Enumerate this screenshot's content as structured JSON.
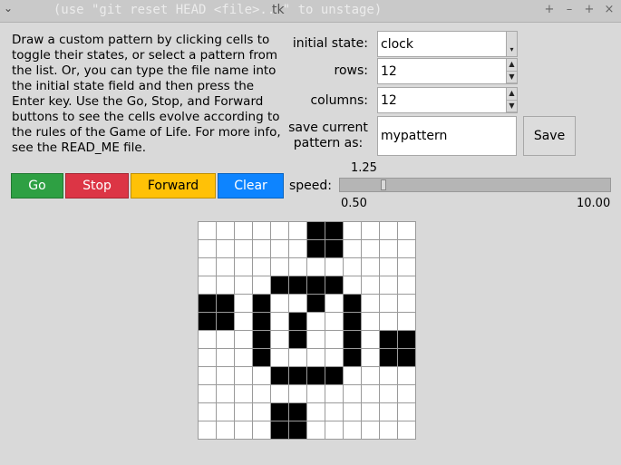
{
  "window": {
    "title": "tk",
    "ghost_text": "  (use \"git reset HEAD <file>...\" to unstage)"
  },
  "instructions": "Draw a custom pattern by clicking cells to toggle their states, or select a pattern from the list. Or, you can type the file name into the initial state field and then press the Enter key. Use the Go, Stop, and Forward buttons to see the cells evolve according to the rules of the Game of Life. For more info, see the READ_ME file.",
  "form": {
    "initial_state_label": "initial state:",
    "initial_state_value": "clock",
    "rows_label": "rows:",
    "rows_value": "12",
    "columns_label": "columns:",
    "columns_value": "12",
    "save_label_line1": "save current",
    "save_label_line2": "pattern as:",
    "save_value": "mypattern",
    "save_button": "Save"
  },
  "controls": {
    "go": "Go",
    "stop": "Stop",
    "forward": "Forward",
    "clear": "Clear",
    "go_color": "#2ea043",
    "stop_color": "#dc3545",
    "forward_color": "#ffc107",
    "clear_color": "#0d84ff"
  },
  "speed": {
    "label": "speed:",
    "value": "1.25",
    "min_label": "0.50",
    "max_label": "10.00",
    "min": 0.5,
    "max": 10.0,
    "current": 1.25
  },
  "board": {
    "rows": 12,
    "cols": 12,
    "live_cells": [
      [
        0,
        6
      ],
      [
        0,
        7
      ],
      [
        1,
        6
      ],
      [
        1,
        7
      ],
      [
        3,
        4
      ],
      [
        3,
        5
      ],
      [
        3,
        6
      ],
      [
        3,
        7
      ],
      [
        4,
        0
      ],
      [
        4,
        1
      ],
      [
        4,
        3
      ],
      [
        4,
        6
      ],
      [
        4,
        8
      ],
      [
        5,
        0
      ],
      [
        5,
        1
      ],
      [
        5,
        3
      ],
      [
        5,
        5
      ],
      [
        5,
        8
      ],
      [
        6,
        3
      ],
      [
        6,
        5
      ],
      [
        6,
        8
      ],
      [
        6,
        10
      ],
      [
        6,
        11
      ],
      [
        7,
        3
      ],
      [
        7,
        8
      ],
      [
        7,
        10
      ],
      [
        7,
        11
      ],
      [
        8,
        4
      ],
      [
        8,
        5
      ],
      [
        8,
        6
      ],
      [
        8,
        7
      ],
      [
        10,
        4
      ],
      [
        10,
        5
      ],
      [
        11,
        4
      ],
      [
        11,
        5
      ]
    ]
  }
}
